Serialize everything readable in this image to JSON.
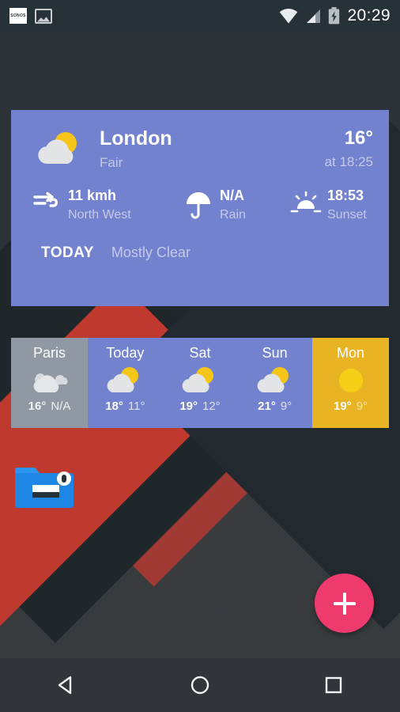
{
  "status_bar": {
    "time": "20:29",
    "left_icons": [
      {
        "name": "sonos-notification-icon",
        "label": "SONOS"
      },
      {
        "name": "photo-notification-icon",
        "label": ""
      }
    ],
    "right_icons": [
      {
        "name": "wifi-icon"
      },
      {
        "name": "cellular-signal-icon"
      },
      {
        "name": "battery-charging-icon"
      }
    ]
  },
  "weather_widget": {
    "condition_icon": "sun-behind-cloud-icon",
    "city": "London",
    "condition": "Fair",
    "temperature": "16°",
    "observed_at": "at 18:25",
    "details": [
      {
        "icon": "wind-icon",
        "value": "11 kmh",
        "label": "North West"
      },
      {
        "icon": "umbrella-icon",
        "value": "N/A",
        "label": "Rain"
      },
      {
        "icon": "sunset-icon",
        "value": "18:53",
        "label": "Sunset"
      }
    ],
    "footer_day": "TODAY",
    "footer_description": "Mostly Clear"
  },
  "forecast_strip": {
    "tiles": [
      {
        "day": "Paris",
        "icon": "clouds-icon",
        "high": "16°",
        "low": "N/A",
        "style": "grey"
      },
      {
        "day": "Today",
        "icon": "sun-behind-cloud-icon",
        "high": "18°",
        "low": "11°",
        "style": "normal"
      },
      {
        "day": "Sat",
        "icon": "sun-behind-cloud-icon",
        "high": "19°",
        "low": "12°",
        "style": "normal"
      },
      {
        "day": "Sun",
        "icon": "sun-behind-cloud-icon",
        "high": "21°",
        "low": "9°",
        "style": "normal"
      },
      {
        "day": "Mon",
        "icon": "sun-icon",
        "high": "19°",
        "low": "9°",
        "style": "accent"
      }
    ]
  },
  "desktop": {
    "folder_shortcut": {
      "icon": "locked-folder-icon",
      "label": ""
    },
    "fab": {
      "icon": "plus-icon",
      "label": ""
    }
  },
  "nav_bar": {
    "buttons": [
      {
        "name": "back-button",
        "icon": "back-triangle-icon"
      },
      {
        "name": "home-button",
        "icon": "home-circle-icon"
      },
      {
        "name": "recents-button",
        "icon": "recents-square-icon"
      }
    ]
  },
  "colors": {
    "widget_purple": "#7382ce",
    "tile_grey": "#9099a3",
    "tile_accent": "#e8b424",
    "fab_pink": "#ef3a6e",
    "background_dark": "#2b3338",
    "wallpaper_red": "#c0392f"
  }
}
